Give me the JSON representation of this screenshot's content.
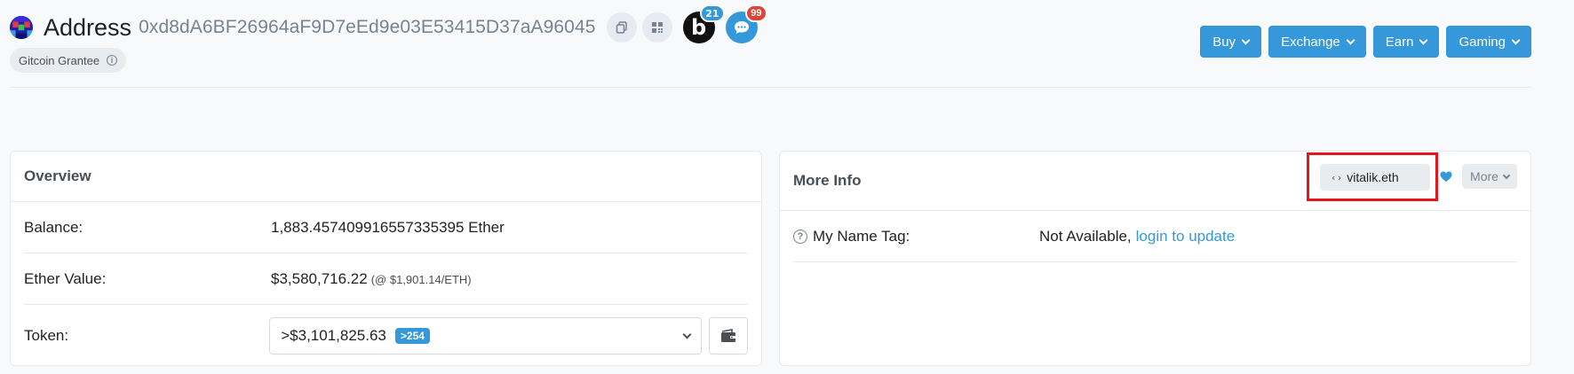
{
  "header": {
    "title": "Address",
    "address": "0xd8dA6BF26964aF9D7eEd9e03E53415D37aA96045",
    "badge_b_count": "21",
    "badge_chat_count": "99",
    "grantee_label": "Gitcoin Grantee",
    "info_glyph": "i"
  },
  "nav": [
    {
      "label": "Buy"
    },
    {
      "label": "Exchange"
    },
    {
      "label": "Earn"
    },
    {
      "label": "Gaming"
    }
  ],
  "overview": {
    "title": "Overview",
    "balance_label": "Balance:",
    "balance_value": "1,883.457409916557335395 Ether",
    "ether_value_label": "Ether Value:",
    "ether_value": "$3,580,716.22",
    "ether_price": "(@ $1,901.14/ETH)",
    "token_label": "Token:",
    "token_value": ">$3,101,825.63",
    "token_count": ">254"
  },
  "more_info": {
    "title": "More Info",
    "ens_name": "vitalik.eth",
    "ens_glyph": "‹›",
    "more_label": "More",
    "name_tag_label": "My Name Tag:",
    "name_tag_value": "Not Available,",
    "name_tag_link": "login to update",
    "q_glyph": "?"
  },
  "icons": {
    "copy": "copy-icon",
    "qr": "qr-code-icon",
    "blockscan": "blockscan-b-icon",
    "chat": "chat-icon",
    "heart": "heart-icon",
    "wallet": "wallet-icon"
  },
  "colors": {
    "accent": "#3498db",
    "highlight": "#e8141c",
    "badge_red": "#de4437"
  }
}
